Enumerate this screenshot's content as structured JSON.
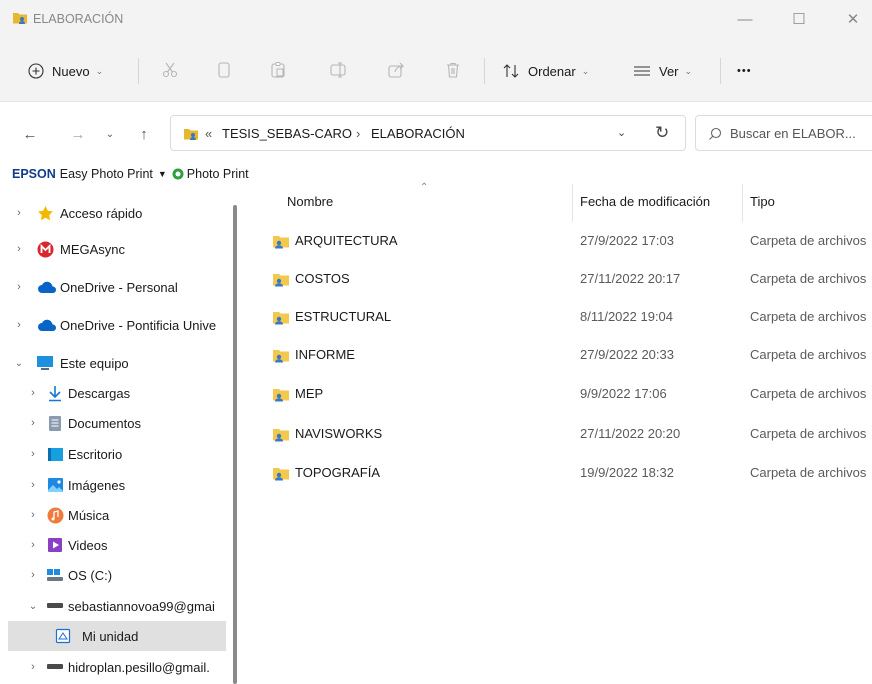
{
  "window": {
    "title": "ELABORACIÓN",
    "minimize_label": "—",
    "maximize_label": "☐",
    "close_label": "✕"
  },
  "toolbar": {
    "new_label": "Nuevo",
    "sort_label": "Ordenar",
    "view_label": "Ver",
    "more_label": "•••"
  },
  "address": {
    "overflow": "«",
    "crumbs": [
      "TESIS_SEBAS-CARO",
      "ELABORACIÓN"
    ],
    "separator": "›"
  },
  "search": {
    "placeholder": "Buscar en ELABOR..."
  },
  "epson": {
    "brand": "EPSON",
    "app": "Easy Photo Print",
    "dropdown": "▼",
    "photo_print": "Photo Print"
  },
  "sidebar": {
    "items": [
      {
        "label": "Acceso rápido",
        "icon": "star-icon"
      },
      {
        "label": "MEGAsync",
        "icon": "mega-icon"
      },
      {
        "label": "OneDrive - Personal",
        "icon": "cloud-icon"
      },
      {
        "label": "OneDrive - Pontificia Unive",
        "icon": "cloud-icon"
      },
      {
        "label": "Este equipo",
        "icon": "computer-icon"
      },
      {
        "label": "Descargas",
        "icon": "download-icon"
      },
      {
        "label": "Documentos",
        "icon": "document-icon"
      },
      {
        "label": "Escritorio",
        "icon": "desktop-icon"
      },
      {
        "label": "Imágenes",
        "icon": "pictures-icon"
      },
      {
        "label": "Música",
        "icon": "music-icon"
      },
      {
        "label": "Videos",
        "icon": "videos-icon"
      },
      {
        "label": "OS (C:)",
        "icon": "drive-icon"
      },
      {
        "label": "sebastiannovoa99@gmai",
        "icon": "network-drive-icon"
      },
      {
        "label": "Mi unidad",
        "icon": "google-drive-icon"
      },
      {
        "label": "hidroplan.pesillo@gmail.",
        "icon": "network-drive-icon"
      }
    ]
  },
  "columns": {
    "name": "Nombre",
    "date": "Fecha de modificación",
    "type": "Tipo"
  },
  "files": [
    {
      "name": "ARQUITECTURA",
      "date": "27/9/2022 17:03",
      "type": "Carpeta de archivos"
    },
    {
      "name": "COSTOS",
      "date": "27/11/2022 20:17",
      "type": "Carpeta de archivos"
    },
    {
      "name": "ESTRUCTURAL",
      "date": "8/11/2022 19:04",
      "type": "Carpeta de archivos"
    },
    {
      "name": "INFORME",
      "date": "27/9/2022 20:33",
      "type": "Carpeta de archivos"
    },
    {
      "name": "MEP",
      "date": "9/9/2022 17:06",
      "type": "Carpeta de archivos"
    },
    {
      "name": "NAVISWORKS",
      "date": "27/11/2022 20:20",
      "type": "Carpeta de archivos"
    },
    {
      "name": "TOPOGRAFÍA",
      "date": "19/9/2022 18:32",
      "type": "Carpeta de archivos"
    }
  ],
  "colors": {
    "folder_shared": "#f2c94c",
    "accent": "#0067c0",
    "selection": "#e0e0e0"
  }
}
